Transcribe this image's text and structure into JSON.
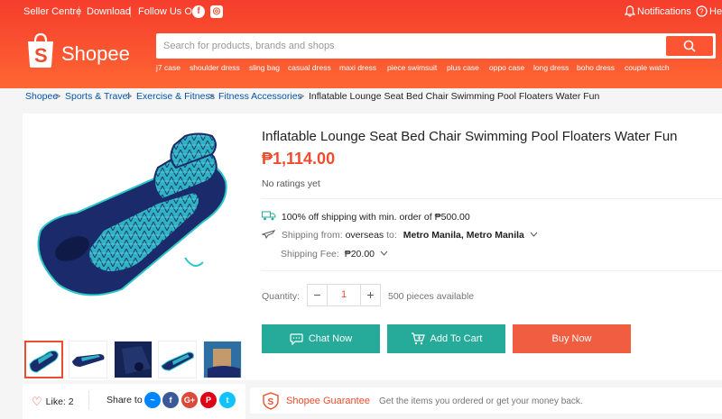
{
  "topbar": {
    "seller_centre": "Seller Centre",
    "download": "Download",
    "follow_us": "Follow Us On",
    "notifications": "Notifications",
    "help": "He"
  },
  "logo": {
    "text": "Shopee"
  },
  "search": {
    "placeholder": "Search for products, brands and shops",
    "suggestions": [
      "j7 case",
      "shoulder dress",
      "sling bag",
      "casual dress",
      "maxi dress",
      "piece swimsuit",
      "plus case",
      "oppo case",
      "long dress",
      "boho dress",
      "couple watch"
    ]
  },
  "breadcrumb": [
    "Shopee",
    "Sports & Travel",
    "Exercise & Fitness",
    "Fitness Accessories",
    "Inflatable Lounge Seat Bed Chair Swimming Pool Floaters Water Fun"
  ],
  "product": {
    "title": "Inflatable Lounge Seat Bed Chair Swimming Pool Floaters Water Fun",
    "price": "₱1,114.00",
    "rating": "No ratings yet"
  },
  "shipping": {
    "free_ship": "100% off shipping with min. order of ₱500.00",
    "from_label": "Shipping",
    "from_word": "from:",
    "from_value": "overseas",
    "to_label": "to:",
    "to_value": "Metro Manila, Metro Manila",
    "fee_label": "Shipping Fee:",
    "fee_value": "₱20.00"
  },
  "quantity": {
    "label": "Quantity:",
    "minus": "−",
    "value": "1",
    "plus": "+",
    "available": "500 pieces available"
  },
  "actions": {
    "chat": "Chat Now",
    "cart": "Add To Cart",
    "buy": "Buy Now"
  },
  "social": {
    "like": "Like: 2",
    "share": "Share to",
    "networks": [
      "messenger",
      "facebook",
      "google-plus",
      "pinterest",
      "twitter"
    ]
  },
  "guarantee": {
    "title": "Shopee Guarantee",
    "text": "Get the items you ordered or get your money back."
  },
  "colors": {
    "brand": "#ee4d2d",
    "teal": "#26aa99",
    "link": "#0055aa",
    "buy": "#f05d40"
  },
  "icons": [
    "facebook-icon",
    "instagram-icon",
    "bell-icon",
    "help-icon",
    "search-icon",
    "truck-icon",
    "plane-icon",
    "chevron-down-icon",
    "chat-icon",
    "cart-icon",
    "heart-icon",
    "shield-icon"
  ]
}
